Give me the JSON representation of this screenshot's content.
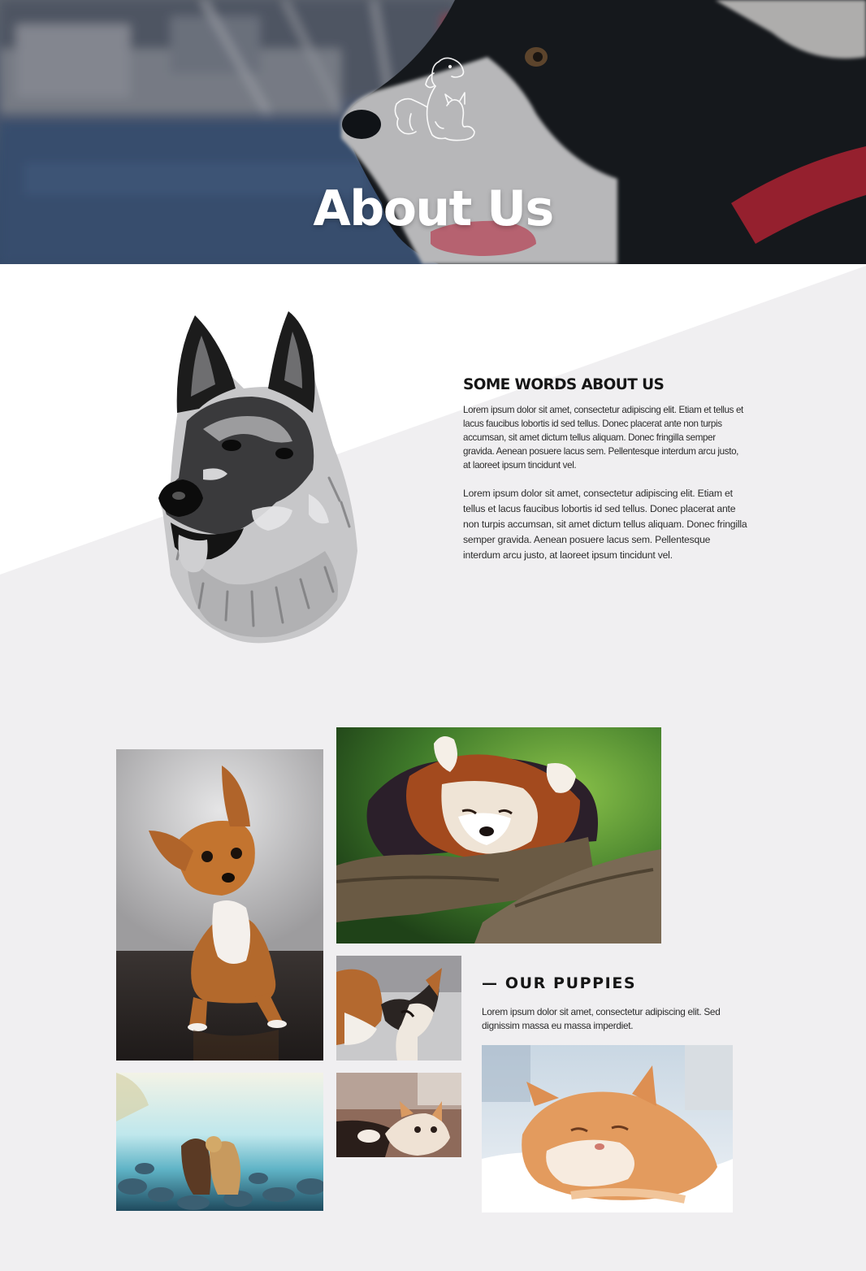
{
  "hero": {
    "title": "About Us",
    "logo_icon": "dog-and-cat-logo-icon"
  },
  "about": {
    "heading": "SOME WORDS ABOUT US",
    "paragraph_1": "Lorem ipsum dolor sit amet, consectetur adipiscing elit. Etiam et tellus et lacus faucibus lobortis id sed tellus. Donec placerat ante non turpis accumsan, sit amet dictum tellus aliquam. Donec fringilla semper gravida. Aenean posuere lacus sem. Pellentesque interdum arcu justo, at laoreet ipsum tincidunt vel.",
    "paragraph_2": "Lorem ipsum dolor sit amet, consectetur adipiscing elit. Etiam et tellus et lacus faucibus lobortis id sed tellus. Donec placerat ante non turpis accumsan, sit amet dictum tellus aliquam. Donec fringilla semper gravida. Aenean posuere lacus sem. Pellentesque interdum arcu justo, at laoreet ipsum tincidunt vel.",
    "illustration": "german-shepherd-illustration"
  },
  "puppies": {
    "heading": "— OUR PUPPIES",
    "text": "Lorem ipsum dolor sit amet, consectetur adipiscing elit. Sed dignissim massa eu massa imperdiet."
  },
  "gallery": [
    "chihuahua-puppy-photo",
    "red-panda-photo",
    "puppy-and-dog-photo",
    "dogs-on-beach-photo",
    "kitten-photo",
    "sleeping-cat-photo"
  ],
  "colors": {
    "page_background": "#f0eff1",
    "white": "#ffffff",
    "heading_text": "#161616",
    "body_text": "#2c2c2c",
    "hero_overlay": "#3a4f70"
  }
}
